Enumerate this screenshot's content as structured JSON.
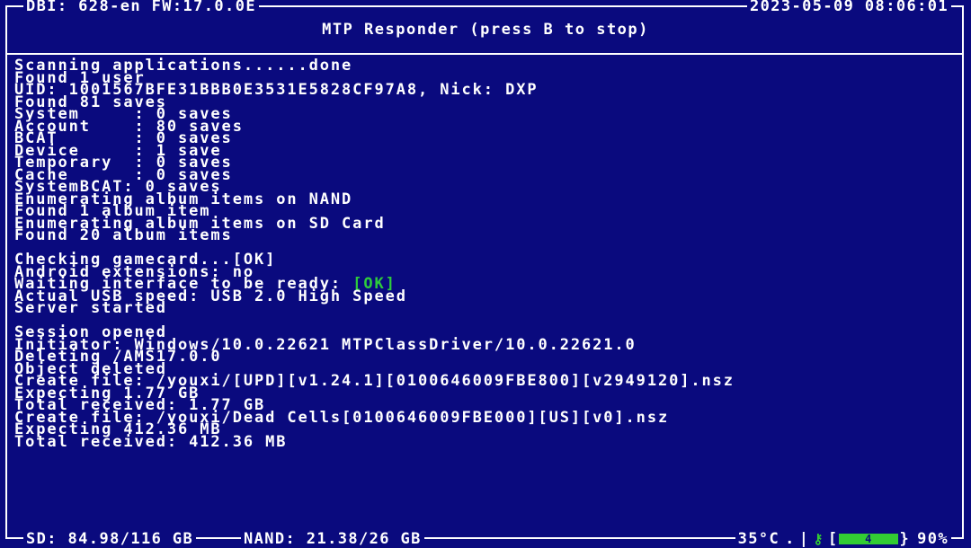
{
  "header": {
    "left": "DBI: 628-en FW:17.0.0E",
    "right": "2023-05-09 08:06:01",
    "title": "MTP Responder (press B to stop)"
  },
  "log": [
    "Scanning applications......done",
    "Found 1 user",
    "UID: 1001567BFE31BBB0E3531E5828CF97A8, Nick: DXP",
    "Found 81 saves",
    "System     : 0 saves",
    "Account    : 80 saves",
    "BCAT       : 0 saves",
    "Device     : 1 save",
    "Temporary  : 0 saves",
    "Cache      : 0 saves",
    "SystemBCAT: 0 saves",
    "Enumerating album items on NAND",
    "Found 1 album item",
    "Enumerating album items on SD Card",
    "Found 20 album items",
    "",
    "Checking gamecard...[OK]",
    "Android extensions: no",
    "__WAIT__",
    "Actual USB speed: USB 2.0 High Speed",
    "Server started",
    "",
    "Session opened",
    "Initiator: Windows/10.0.22621 MTPClassDriver/10.0.22621.0",
    "Deleting /AMS17.0.0",
    "Object deleted",
    "Create file: /youxi/[UPD][v1.24.1][0100646009FBE800][v2949120].nsz",
    "Expecting 1.77 GB",
    "Total received: 1.77 GB",
    "Create file: /youxi/Dead Cells[0100646009FBE000][US][v0].nsz",
    "Expecting 412.36 MB",
    "Total received: 412.36 MB"
  ],
  "wait_line": {
    "prefix": "Waiting interface to be ready: ",
    "status": "[OK]",
    "status_color": "#2ecc3c"
  },
  "footer": {
    "sd": "SD: 84.98/116 GB",
    "nand": "NAND: 21.38/26 GB",
    "temperature": "35°C",
    "battery_value": "4",
    "battery_percent": "90%",
    "battery_level": 0.9
  },
  "colors": {
    "background": "#0a0a7e",
    "text": "#ffffff",
    "ok": "#2ecc3c"
  }
}
